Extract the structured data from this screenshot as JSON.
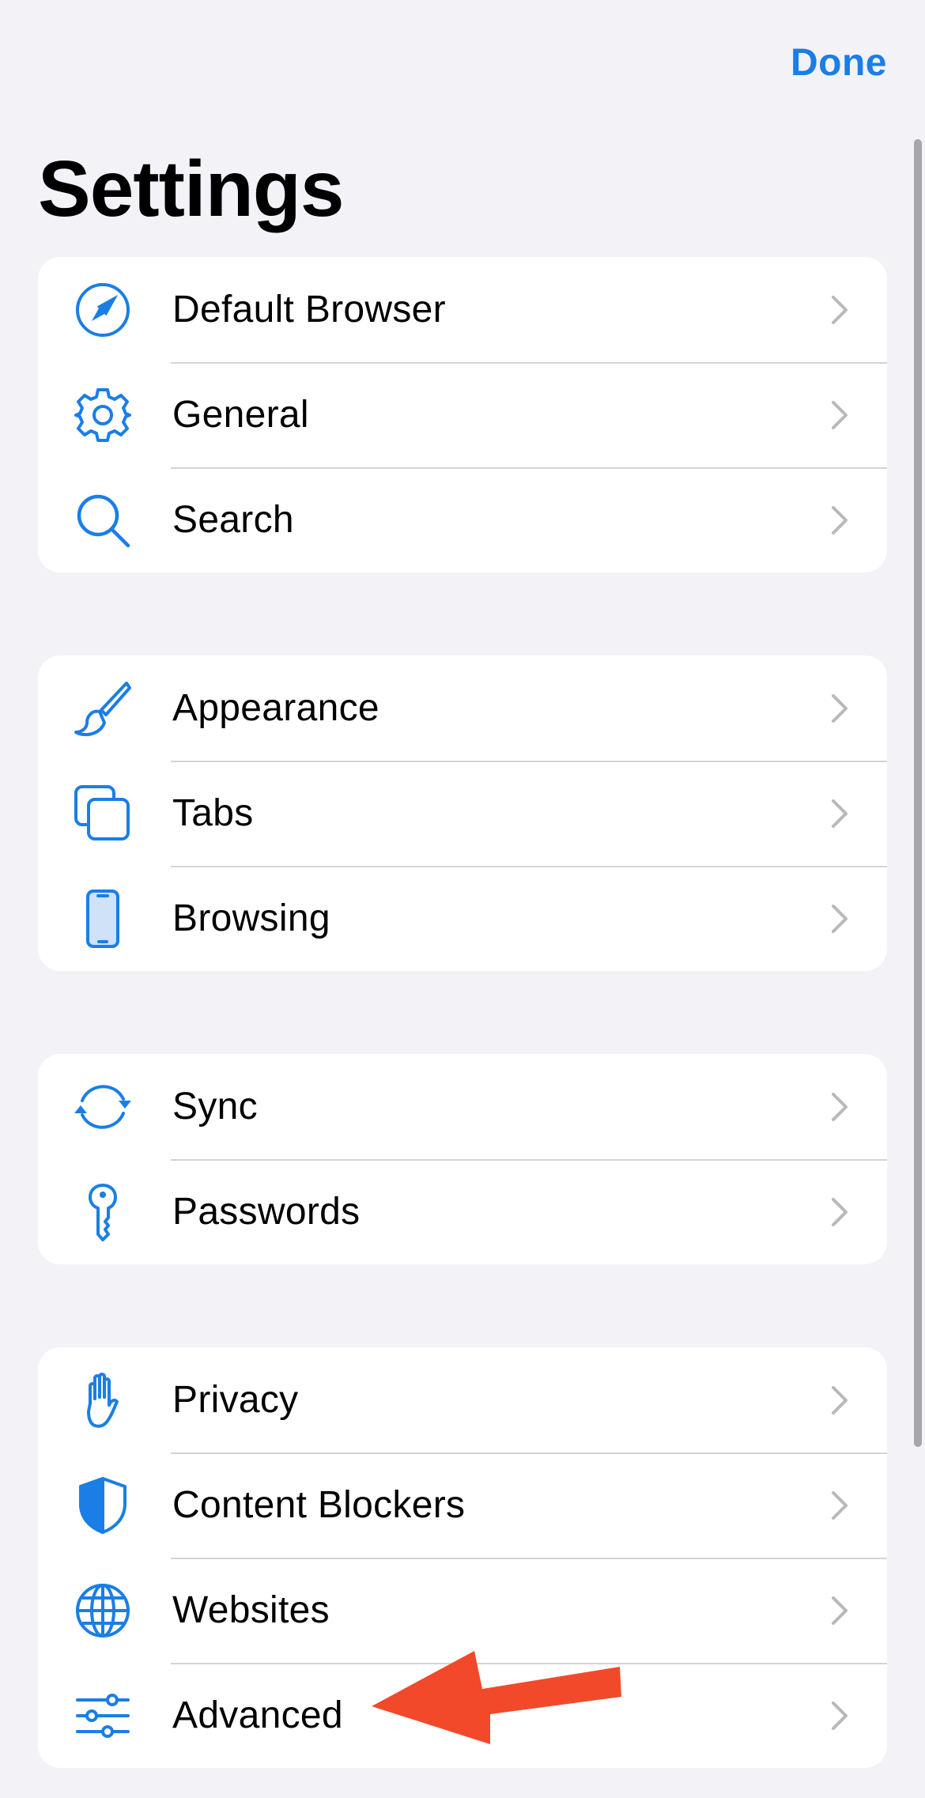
{
  "header": {
    "done_label": "Done",
    "title": "Settings"
  },
  "colors": {
    "accent": "#1a7ee6",
    "background": "#f2f2f7",
    "annotation_arrow": "#f2492b"
  },
  "groups": [
    {
      "items": [
        {
          "label": "Default Browser",
          "icon": "compass-icon"
        },
        {
          "label": "General",
          "icon": "gear-icon"
        },
        {
          "label": "Search",
          "icon": "search-icon"
        }
      ]
    },
    {
      "items": [
        {
          "label": "Appearance",
          "icon": "paintbrush-icon"
        },
        {
          "label": "Tabs",
          "icon": "tabs-icon"
        },
        {
          "label": "Browsing",
          "icon": "phone-icon"
        }
      ]
    },
    {
      "items": [
        {
          "label": "Sync",
          "icon": "sync-icon"
        },
        {
          "label": "Passwords",
          "icon": "key-icon"
        }
      ]
    },
    {
      "items": [
        {
          "label": "Privacy",
          "icon": "hand-icon"
        },
        {
          "label": "Content Blockers",
          "icon": "shield-icon"
        },
        {
          "label": "Websites",
          "icon": "globe-icon"
        },
        {
          "label": "Advanced",
          "icon": "sliders-icon"
        }
      ]
    }
  ]
}
